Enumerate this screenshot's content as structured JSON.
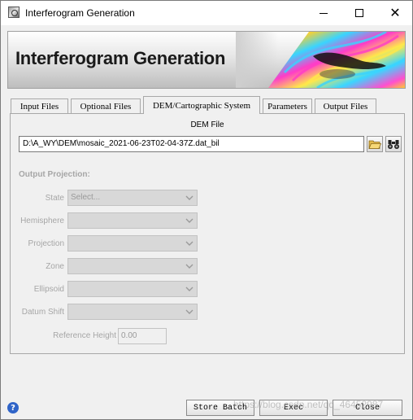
{
  "window": {
    "title": "Interferogram Generation"
  },
  "banner": {
    "title": "Interferogram Generation"
  },
  "tabs": [
    {
      "label": "Input Files"
    },
    {
      "label": "Optional Files"
    },
    {
      "label": "DEM/Cartographic System",
      "active": true
    },
    {
      "label": "Parameters"
    },
    {
      "label": "Output Files"
    }
  ],
  "dem": {
    "label": "DEM File",
    "path": "D:\\A_WY\\DEM\\mosaic_2021-06-23T02-04-37Z.dat_bil"
  },
  "projection": {
    "section_title": "Output Projection:",
    "fields": [
      {
        "label": "State",
        "value": "Select..."
      },
      {
        "label": "Hemisphere",
        "value": ""
      },
      {
        "label": "Projection",
        "value": ""
      },
      {
        "label": "Zone",
        "value": ""
      },
      {
        "label": "Ellipsoid",
        "value": ""
      },
      {
        "label": "Datum Shift",
        "value": ""
      }
    ],
    "reference_height_label": "Reference Height",
    "reference_height_value": "0.00"
  },
  "buttons": {
    "store_batch": "Store Batch",
    "exec": "Exec",
    "close": "Close"
  },
  "watermark": "https://blog.csdn.net/qq_46452987",
  "icons": {
    "open_folder": "folder-open-icon",
    "browse": "binoculars-icon",
    "help": "help-icon"
  }
}
